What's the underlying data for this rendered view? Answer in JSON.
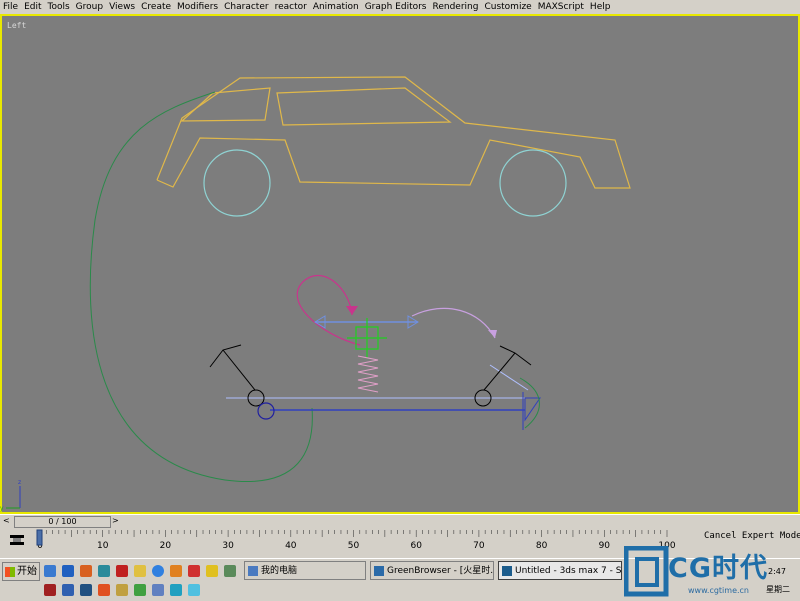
{
  "menu": {
    "items": [
      "File",
      "Edit",
      "Tools",
      "Group",
      "Views",
      "Create",
      "Modifiers",
      "Character",
      "reactor",
      "Animation",
      "Graph Editors",
      "Rendering",
      "Customize",
      "MAXScript",
      "Help"
    ]
  },
  "viewport": {
    "label": "Left"
  },
  "timeline": {
    "slider_text": "0 / 100",
    "left_arrow": "<",
    "right_arrow": ">",
    "ruler_labels": [
      "0",
      "10",
      "20",
      "30",
      "40",
      "50",
      "60",
      "70",
      "80",
      "90",
      "100"
    ]
  },
  "status": {
    "text": "Cancel Expert Mode"
  },
  "taskbar": {
    "start_label": "开始",
    "tasks": [
      {
        "label": "我的电脑"
      },
      {
        "label": "GreenBrowser - [火星时..."
      },
      {
        "label": "Untitled - 3ds max 7 - St..."
      }
    ],
    "tray_time": "2:47",
    "tray_day": "星期二"
  },
  "watermark": {
    "brand": "CG时代",
    "url": "www.cgtime.cn"
  },
  "colors": {
    "viewport_bg": "#7d7d7d",
    "viewport_border": "#e8e800",
    "car_body": "#e0b84a",
    "wheels": "#8fd3d3",
    "path_curve": "#2a8a4a",
    "spring": "#e0a0c8",
    "arc_magenta": "#c8358c",
    "brand_blue": "#1f6ea8"
  }
}
